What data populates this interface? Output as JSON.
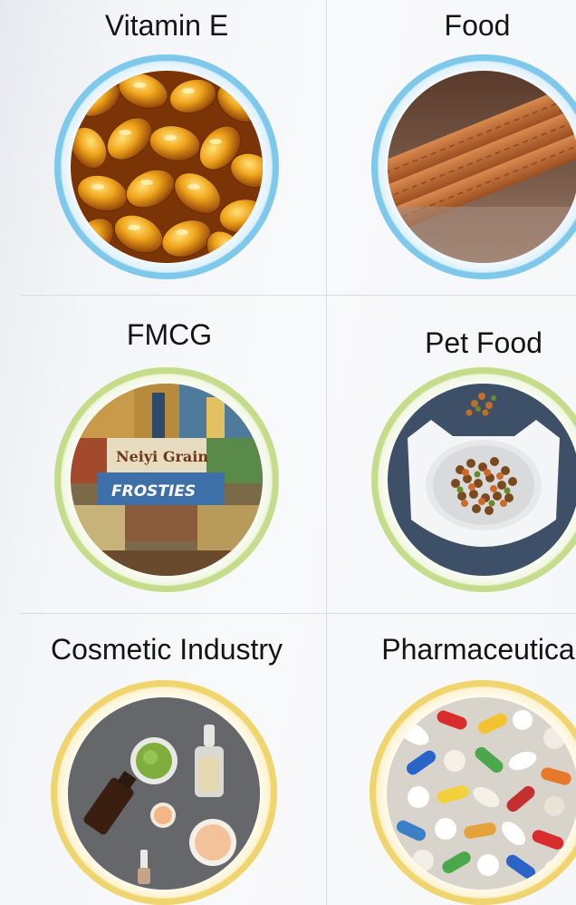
{
  "tiles": [
    {
      "label": "Vitamin E",
      "image": "vitamin-e-softgel-capsules"
    },
    {
      "label": "Food",
      "image": "biscuits"
    },
    {
      "label": "FMCG",
      "image": "packaged-consumer-goods"
    },
    {
      "label": "Pet Food",
      "image": "pet-food-bowl"
    },
    {
      "label": "Cosmetic Industry",
      "image": "cosmetic-bottles"
    },
    {
      "label": "Pharmaceutica",
      "image": "assorted-pills"
    }
  ],
  "colors": {
    "ring_blue": "#7ec8ec",
    "ring_green": "#c5dd8b",
    "ring_yellow": "#f0d56e",
    "label": "#141414",
    "divider": "#d9dde3"
  }
}
